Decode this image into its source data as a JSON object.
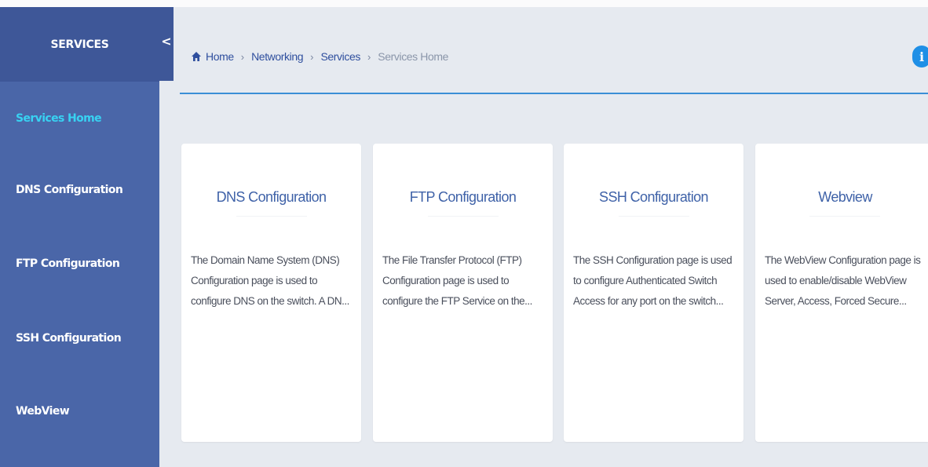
{
  "sidebar": {
    "title": "SERVICES",
    "items": [
      {
        "label": "Services Home",
        "active": true
      },
      {
        "label": "DNS Configuration"
      },
      {
        "label": "FTP Configuration"
      },
      {
        "label": "SSH Configuration"
      },
      {
        "label": "WebView"
      }
    ],
    "collapse_glyph": "<"
  },
  "breadcrumb": {
    "home_icon": "home-icon",
    "items": [
      "Home",
      "Networking",
      "Services"
    ],
    "separator": "›",
    "current": "Services Home"
  },
  "info_icon": "i",
  "cards": [
    {
      "title": "DNS Configuration",
      "desc_lines": [
        "The Domain Name System (DNS)",
        "Configuration page is used to",
        "configure DNS on the switch. A DN..."
      ]
    },
    {
      "title": "FTP Configuration",
      "desc_lines": [
        "The File Transfer Protocol (FTP)",
        "Configuration page is used to",
        "configure the FTP Service on the..."
      ]
    },
    {
      "title": "SSH Configuration",
      "desc_lines": [
        "The SSH Configuration page is used",
        "to configure Authenticated Switch",
        "Access for any port on the switch..."
      ]
    },
    {
      "title": "Webview",
      "desc_lines": [
        "The WebView Configuration page is",
        "used to enable/disable WebView",
        "Server, Access, Forced Secure..."
      ]
    }
  ],
  "colors": {
    "sidebar_bg": "#4a66a8",
    "sidebar_header_bg": "#3e5798",
    "active_item": "#38d2f2",
    "content_bg": "#e6eaf0",
    "card_title": "#3f62a8",
    "divider": "#3a8fd6",
    "info_icon": "#1f8fe6"
  }
}
